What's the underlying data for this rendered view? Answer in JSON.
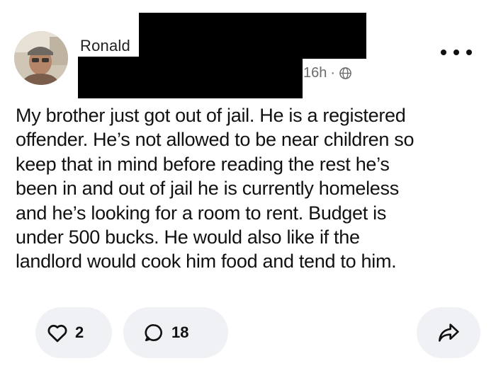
{
  "author": {
    "name": "Ronald"
  },
  "meta": {
    "timestamp": "16h",
    "separator": "·",
    "visibility_icon": "globe-icon"
  },
  "menu": {
    "icon": "more-horizontal-icon"
  },
  "post": {
    "lines": [
      "My brother just got out of jail. He is a registered",
      "offender. He’s not allowed to be near children so",
      "keep that in mind before reading the rest he’s",
      "been in and out of jail he is currently homeless",
      "and he’s looking for a room to rent. Budget is",
      "under 500 bucks. He would also like if the",
      "landlord would cook him food and tend to him."
    ]
  },
  "actions": {
    "like": {
      "icon": "heart-icon",
      "count": "2"
    },
    "comment": {
      "icon": "comment-icon",
      "count": "18"
    },
    "share": {
      "icon": "share-arrow-icon"
    }
  },
  "colors": {
    "background": "#ffffff",
    "pill_background": "#f0f1f4",
    "text": "#111111",
    "muted_text": "#6b6b6b",
    "redaction": "#000000"
  }
}
